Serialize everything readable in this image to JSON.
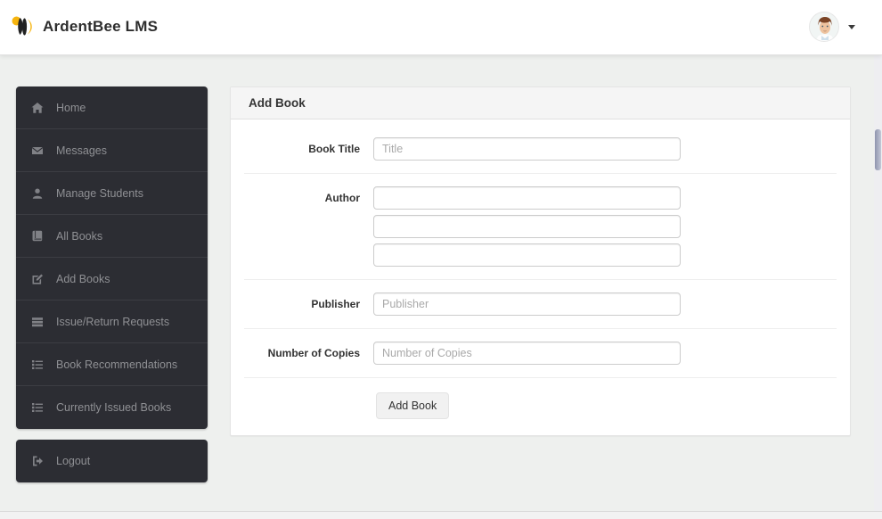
{
  "header": {
    "brand": "ArdentBee LMS"
  },
  "sidebar": {
    "items": [
      {
        "label": "Home",
        "icon": "home-icon"
      },
      {
        "label": "Messages",
        "icon": "envelope-icon"
      },
      {
        "label": "Manage Students",
        "icon": "user-icon"
      },
      {
        "label": "All Books",
        "icon": "book-icon"
      },
      {
        "label": "Add Books",
        "icon": "edit-icon"
      },
      {
        "label": "Issue/Return Requests",
        "icon": "stacked-bars-icon"
      },
      {
        "label": "Book Recommendations",
        "icon": "list-icon"
      },
      {
        "label": "Currently Issued Books",
        "icon": "list-icon"
      }
    ],
    "logout_label": "Logout"
  },
  "panel": {
    "title": "Add Book",
    "form": {
      "book_title": {
        "label": "Book Title",
        "placeholder": "Title"
      },
      "author": {
        "label": "Author"
      },
      "publisher": {
        "label": "Publisher",
        "placeholder": "Publisher"
      },
      "copies": {
        "label": "Number of Copies",
        "placeholder": "Number of Copies"
      },
      "submit_label": "Add Book"
    }
  },
  "colors": {
    "brand_yellow": "#f6b40e",
    "sidebar_bg": "#2c2d33",
    "panel_header_bg": "#f5f5f5",
    "scrollbar_thumb": "#9aa0b8",
    "page_bg": "#eef0ee"
  }
}
